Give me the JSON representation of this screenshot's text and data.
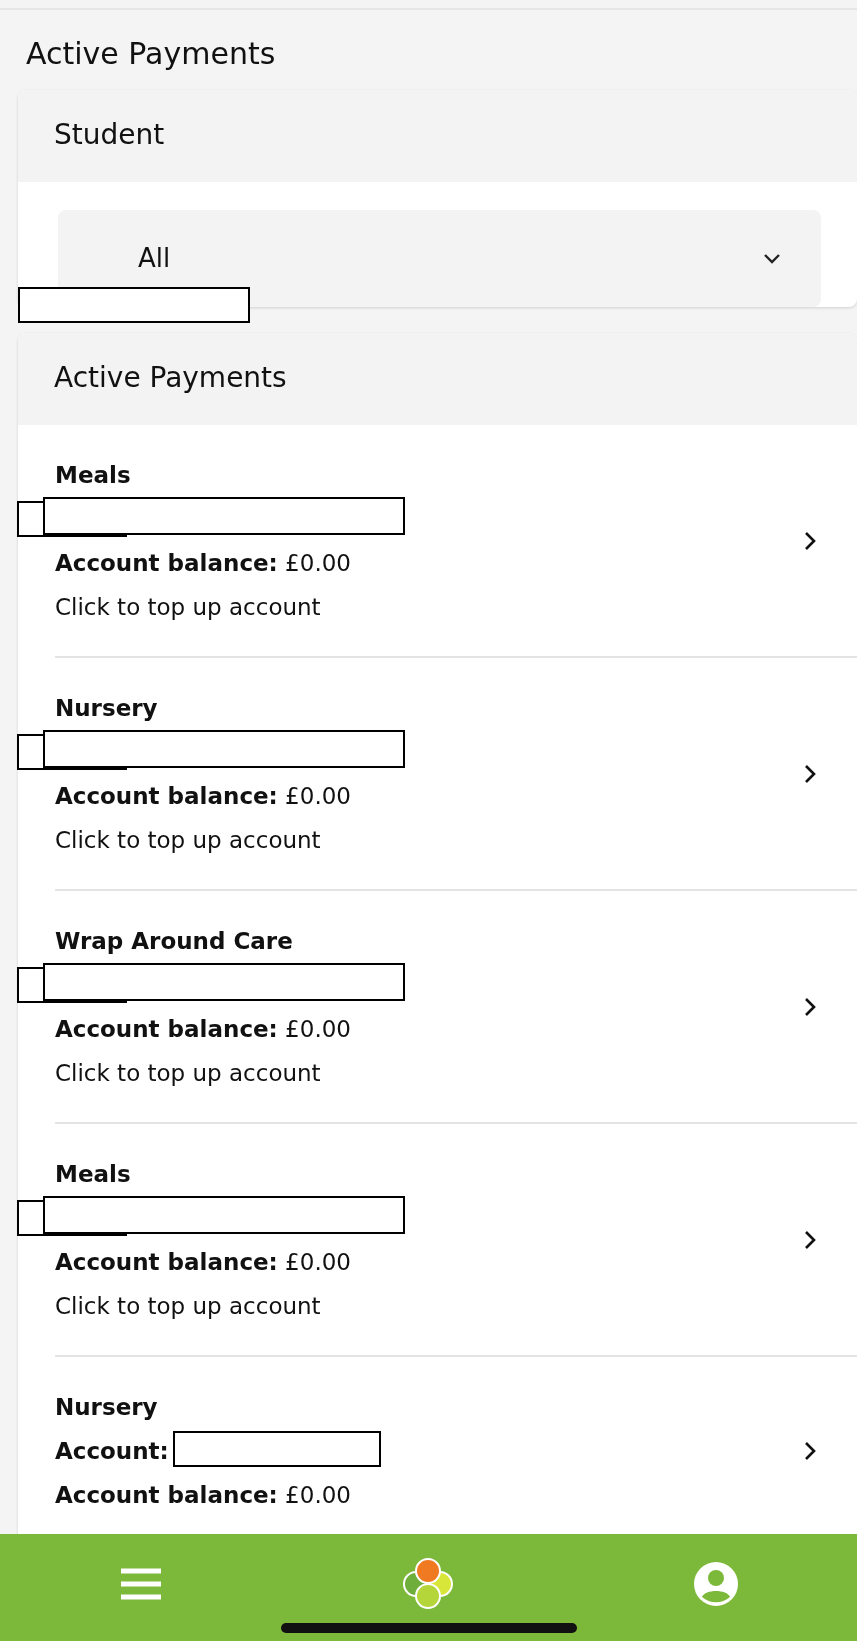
{
  "page_title": "Active Payments",
  "student_card": {
    "header": "Student",
    "select": {
      "value": "All"
    }
  },
  "payments_card": {
    "header": "Active Payments",
    "items": [
      {
        "title": "Meals",
        "balance_label": "Account balance:",
        "balance": "£0.00",
        "action": "Click to top up account"
      },
      {
        "title": "Nursery",
        "balance_label": "Account balance:",
        "balance": "£0.00",
        "action": "Click to top up account"
      },
      {
        "title": "Wrap Around Care",
        "balance_label": "Account balance:",
        "balance": "£0.00",
        "action": "Click to top up account"
      },
      {
        "title": "Meals",
        "balance_label": "Account balance:",
        "balance": "£0.00",
        "action": "Click to top up account"
      },
      {
        "title": "Nursery",
        "account_label": "Account:",
        "balance_label": "Account balance:",
        "balance": "£0.00"
      }
    ]
  }
}
